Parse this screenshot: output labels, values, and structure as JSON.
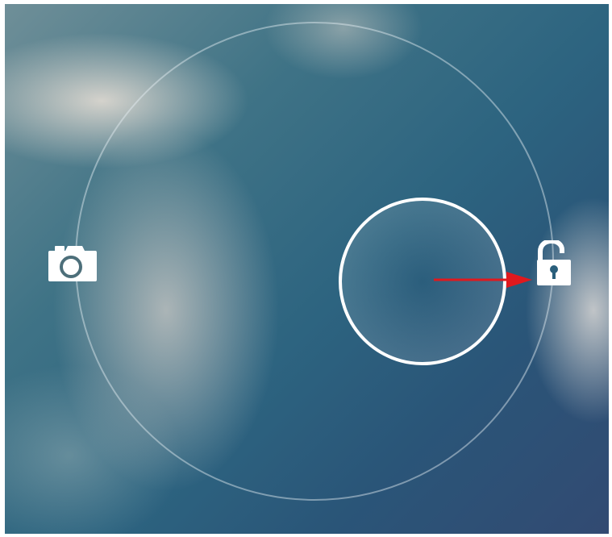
{
  "lockscreen": {
    "shortcuts": [
      {
        "name": "camera",
        "icon": "camera-icon"
      },
      {
        "name": "unlock",
        "icon": "unlock-icon"
      }
    ],
    "handle": "unlock-handle",
    "annotation": {
      "arrow_color": "#e0191e",
      "direction": "right"
    }
  },
  "colors": {
    "ring": "#e6f0f5",
    "handle_border": "#ffffff",
    "icon": "#ffffff"
  }
}
